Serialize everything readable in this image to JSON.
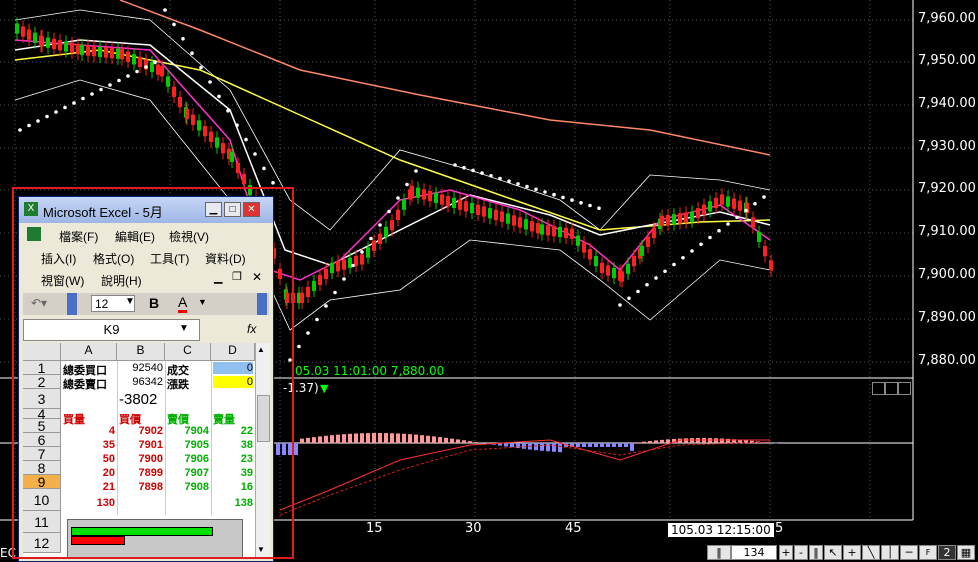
{
  "price_axis": {
    "labels": [
      "7,960.00",
      "7,950.00",
      "7,940.00",
      "7,930.00",
      "7,920.00",
      "7,910.00",
      "7,900.00",
      "7,890.00",
      "7,880.00"
    ]
  },
  "time_axis": {
    "labels": [
      "15",
      "30",
      "45"
    ],
    "cursor_label": "105.03 12:15:00",
    "cursor_tail": "5"
  },
  "info_line": {
    "text": "05.03 11:01:00  7,880.00",
    "macd_text": "-1.37)"
  },
  "excel": {
    "title": "Microsoft Excel - 5月",
    "menu": [
      [
        "檔案(F)",
        "編輯(E)",
        "檢視(V)"
      ],
      [
        "插入(I)",
        "格式(O)",
        "工具(T)",
        "資料(D)"
      ],
      [
        "視窗(W)",
        "說明(H)"
      ]
    ],
    "font_size": "12",
    "bold_label": "B",
    "font_color_label": "A",
    "name_box": "K9",
    "fx_label": "fx",
    "columns": [
      "A",
      "B",
      "C",
      "D"
    ],
    "rows": [
      "1",
      "2",
      "3",
      "4",
      "5",
      "6",
      "7",
      "8",
      "9",
      "10",
      "11",
      "12"
    ],
    "cells": {
      "r1": [
        "總委買口",
        "92540",
        "成交",
        "0"
      ],
      "r2": [
        "總委賣口",
        "96342",
        "漲跌",
        "0"
      ],
      "r3": [
        "",
        "-3802",
        "",
        ""
      ],
      "r4": [
        "買量",
        "買價",
        "賣價",
        "賣量"
      ],
      "orders": [
        [
          "4",
          "7902",
          "7904",
          "22"
        ],
        [
          "35",
          "7901",
          "7905",
          "38"
        ],
        [
          "50",
          "7900",
          "7906",
          "23"
        ],
        [
          "20",
          "7899",
          "7907",
          "39"
        ],
        [
          "21",
          "7898",
          "7908",
          "16"
        ]
      ],
      "r10": [
        "130",
        "",
        "",
        "138"
      ]
    }
  },
  "status_bar": {
    "left_text": "EC",
    "zoom_value": "134",
    "plus": "+",
    "minus": "-",
    "num_label": "2"
  },
  "colors": {
    "up_candle": "#ff2020",
    "down_candle": "#00cc00",
    "ma_yellow": "#ffff40",
    "ma_white": "#ffffff",
    "ma_magenta": "#ff33cc",
    "ma_salmon": "#ff8866",
    "macd_pos": "#ff9999",
    "macd_neg": "#8888ff",
    "highlight_box": "#e01b1b"
  }
}
